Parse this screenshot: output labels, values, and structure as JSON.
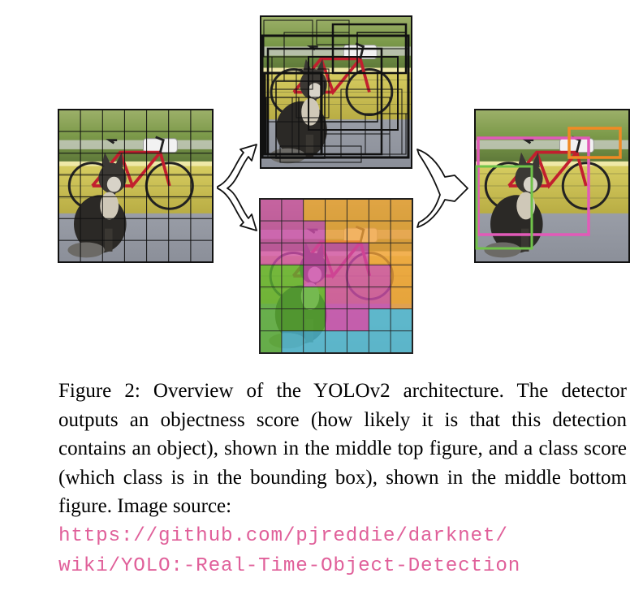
{
  "figure": {
    "input_image": "dog-bicycle-photo-with-grid",
    "objectness_image": "dog-bicycle-photo-with-many-boxes",
    "class_map_image": "grid-class-probability-map",
    "output_image": "dog-bicycle-photo-final-detections",
    "colors": {
      "class_pink": "#d24fb0",
      "class_orange": "#f3a23a",
      "class_green": "#5cb534",
      "class_cyan": "#4fc0d7",
      "box_pink": "#e25ab8",
      "box_orange": "#f08a24",
      "box_green": "#70c34a"
    },
    "arrows": [
      "split-arrow-icon",
      "merge-arrow-icon"
    ]
  },
  "caption": {
    "text": "Figure 2: Overview of the YOLOv2 architecture.  The detector outputs an objectness score (how likely it is that this detection contains an object), shown in the middle top figure, and a class score (which class is in the bounding box), shown in the middle bottom figure. Image source: ",
    "url_line1": "https://github.com/pjreddie/darknet/",
    "url_line2": "wiki/YOLO:-Real-Time-Object-Detection",
    "url_color": "#e0609a"
  }
}
